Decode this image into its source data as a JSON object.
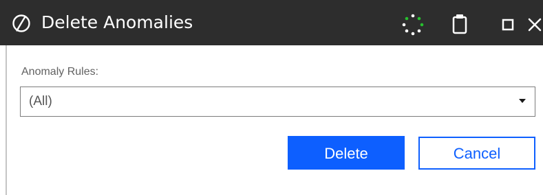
{
  "window": {
    "title": "Delete Anomalies",
    "logo_icon": "circle-slash-icon",
    "status_icon": "loading-spinner-icon",
    "clipboard_icon": "clipboard-icon",
    "maximize_icon": "maximize-icon",
    "close_icon": "close-icon",
    "colors": {
      "titlebar": "#2d2d2d",
      "accent": "#0d5fff",
      "spinner": "#27c02f"
    }
  },
  "form": {
    "anomaly_rules_label": "Anomaly Rules:",
    "anomaly_rules_value": "(All)",
    "dropdown_icon": "caret-down-icon"
  },
  "actions": {
    "delete_label": "Delete",
    "cancel_label": "Cancel"
  }
}
